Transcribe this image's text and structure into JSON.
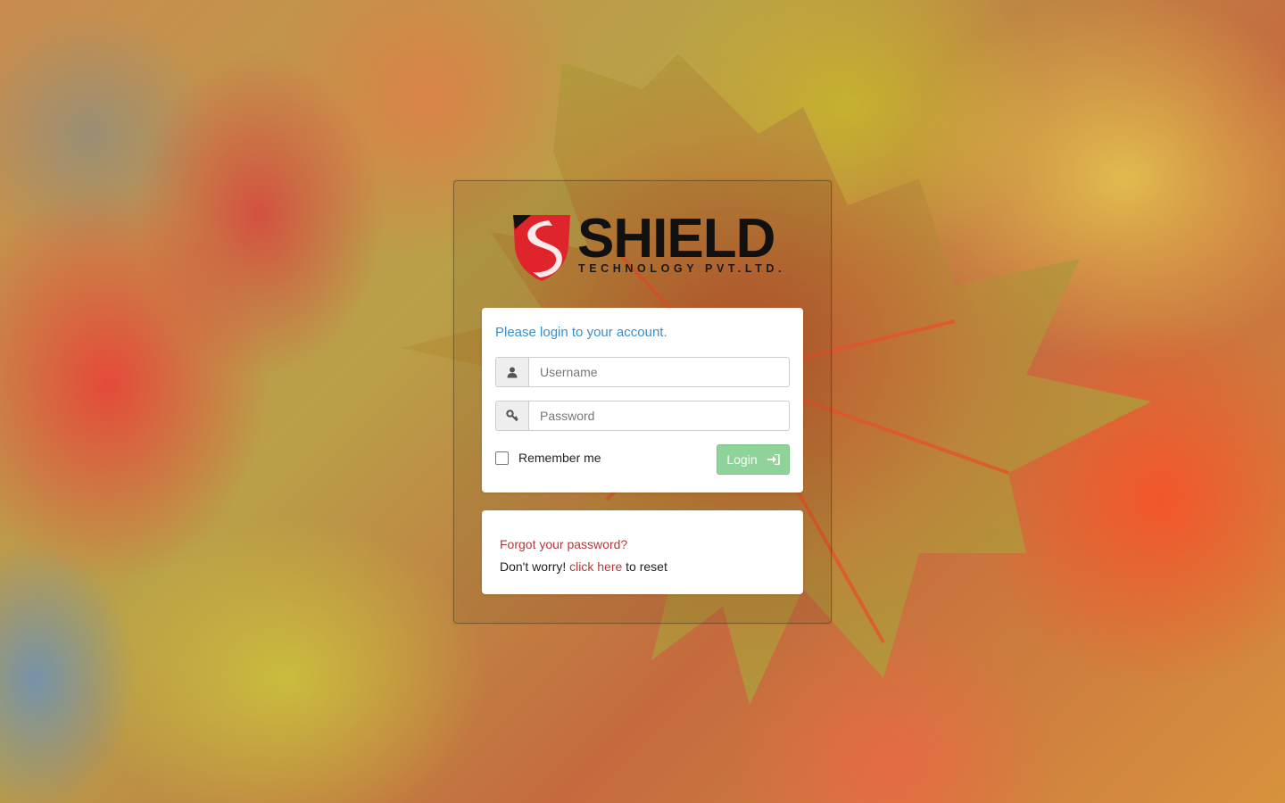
{
  "brand": {
    "name": "SHIELD",
    "tagline": "TECHNOLOGY PVT.LTD."
  },
  "login": {
    "heading": "Please login to your account.",
    "username_placeholder": "Username",
    "password_placeholder": "Password",
    "remember_label": "Remember me",
    "remember_checked": false,
    "button_label": "Login"
  },
  "forgot": {
    "title": "Forgot your password?",
    "prefix": "Don't worry!",
    "link_label": "click here",
    "suffix": "to reset"
  },
  "icons": {
    "username": "user-icon",
    "password": "key-icon",
    "login": "sign-in-icon",
    "logo": "shield-logo-icon"
  },
  "colors": {
    "heading": "#3b8fc6",
    "link": "#b23a3a",
    "button": "#8fd29a",
    "brand_red": "#e0242b"
  }
}
